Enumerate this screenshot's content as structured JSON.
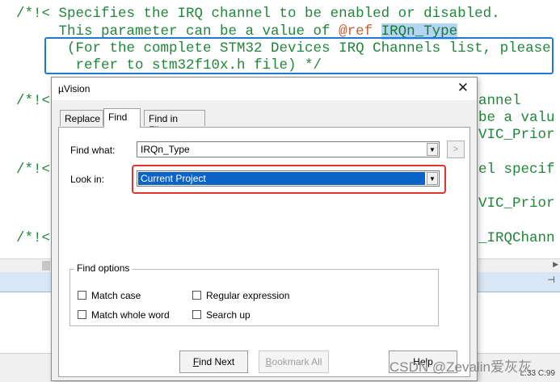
{
  "editor": {
    "line1": "/*!< Specifies the IRQ channel to be enabled or disabled.",
    "line2_prefix": "     This parameter can be a value of ",
    "line2_ref": "@ref",
    "line2_space": " ",
    "line2_highlight": "IRQn_Type",
    "line3": "      (For the complete STM32 Devices IRQ Channels list, please",
    "line4": "       refer to stm32f10x.h file) */",
    "line5_left": "/*!<",
    "line5_right": "annel",
    "line6_right": "be a valu",
    "line7_right": "VIC_Prior",
    "line8_left": "/*!<",
    "line8_right": "el specif",
    "line9_right": "VIC_Prior",
    "line10_left": "/*!<",
    "line10_right": "_IRQChann"
  },
  "dialog": {
    "title": "µVision",
    "close_glyph": "✕",
    "tabs": [
      "Replace",
      "Find",
      "Find in Files"
    ],
    "active_tab": "Find",
    "find_what_label": "Find what:",
    "find_what_value": "IRQn_Type",
    "find_what_more": ">",
    "look_in_label": "Look in:",
    "look_in_value": "Current Project",
    "dropdown_glyph": "▼",
    "find_options_title": "Find options",
    "options": {
      "match_case": "Match case",
      "match_whole_word": "Match whole word",
      "regular_expression": "Regular expression",
      "search_up": "Search up"
    },
    "buttons": {
      "find_next_u": "F",
      "find_next_rest": "ind Next",
      "bookmark_u": "B",
      "bookmark_rest": "ookmark All",
      "help": "Help"
    }
  },
  "status": {
    "position": "L:33 C:99"
  },
  "watermark": "CSDN @Zevalin爱灰灰",
  "colors": {
    "comment_green": "#22863a",
    "selection_blue": "#0a64c8",
    "highlight_box_red": "#e0352b",
    "highlight_box_blue": "#1e7ad7"
  }
}
